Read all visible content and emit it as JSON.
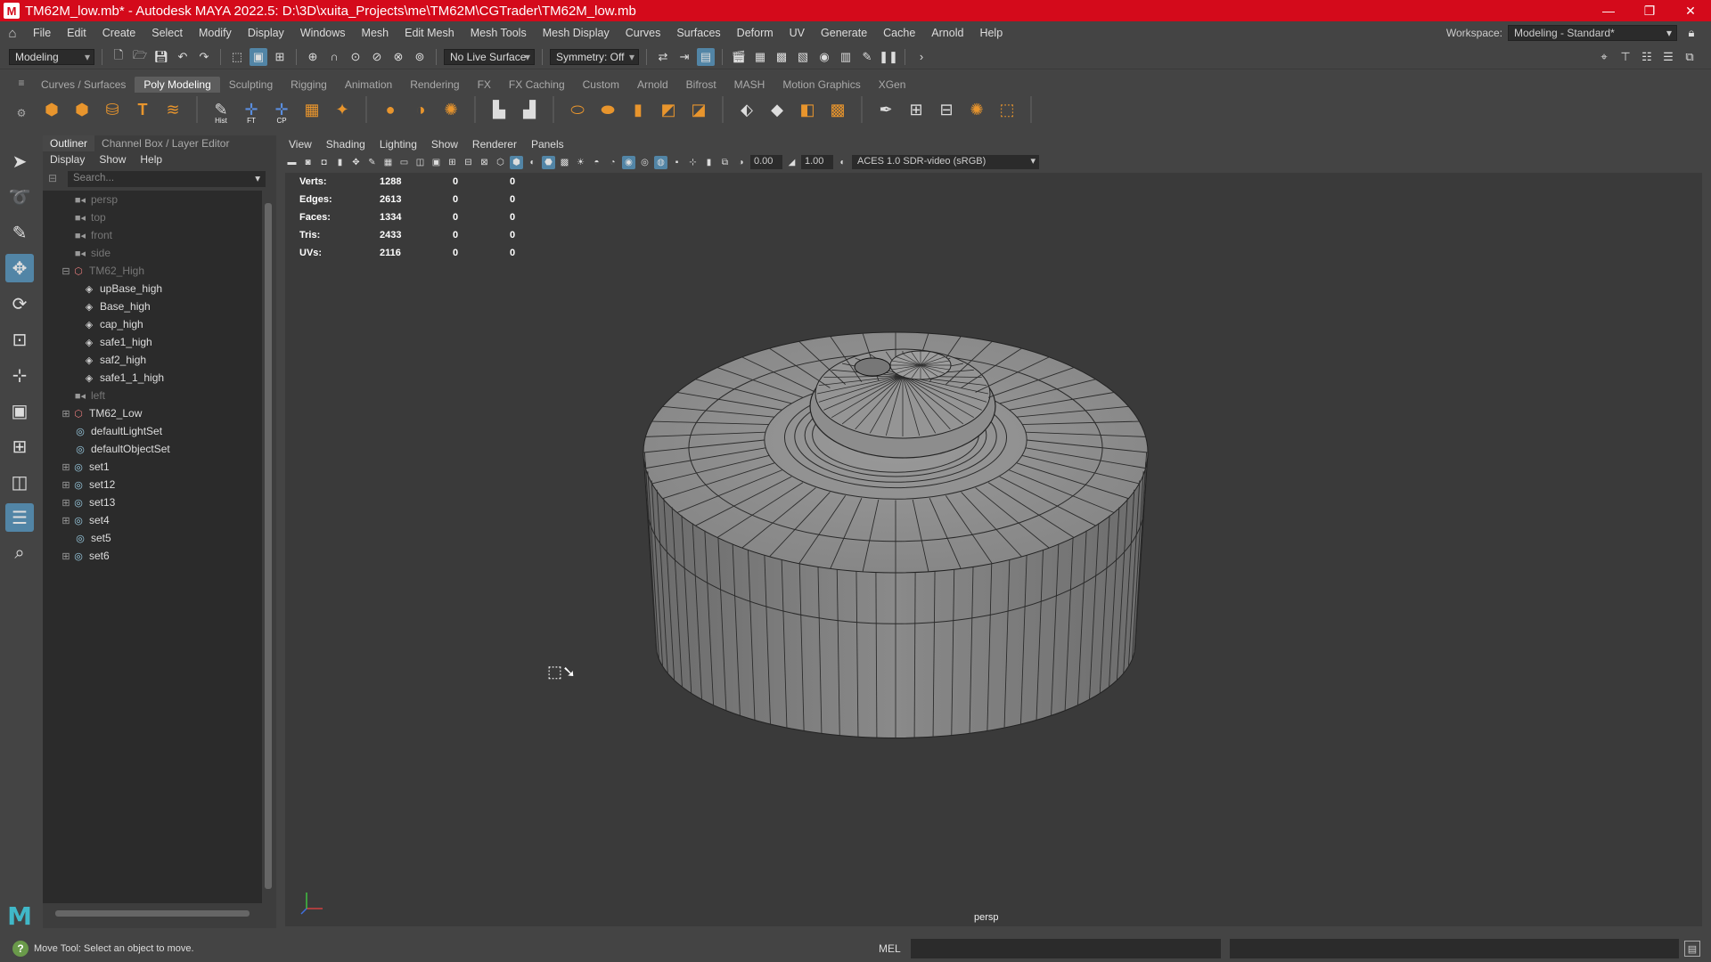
{
  "window": {
    "title": "TM62M_low.mb* - Autodesk MAYA 2022.5: D:\\3D\\xuita_Projects\\me\\TM62M\\CGTrader\\TM62M_low.mb",
    "app_icon": "M"
  },
  "menubar": {
    "items": [
      "File",
      "Edit",
      "Create",
      "Select",
      "Modify",
      "Display",
      "Windows",
      "Mesh",
      "Edit Mesh",
      "Mesh Tools",
      "Mesh Display",
      "Curves",
      "Surfaces",
      "Deform",
      "UV",
      "Generate",
      "Cache",
      "Arnold",
      "Help"
    ],
    "workspace_label": "Workspace:",
    "workspace_value": "Modeling - Standard*"
  },
  "statusline": {
    "menuset": "Modeling",
    "live_surface": "No Live Surface",
    "symmetry": "Symmetry: Off"
  },
  "shelf": {
    "tabs": [
      "Curves / Surfaces",
      "Poly Modeling",
      "Sculpting",
      "Rigging",
      "Animation",
      "Rendering",
      "FX",
      "FX Caching",
      "Custom",
      "Arnold",
      "Bifrost",
      "MASH",
      "Motion Graphics",
      "XGen"
    ],
    "active_tab": "Poly Modeling",
    "labels": {
      "hist": "Hist",
      "ft": "FT",
      "cp": "CP"
    }
  },
  "outliner": {
    "tabs": [
      "Outliner",
      "Channel Box / Layer Editor"
    ],
    "menu": [
      "Display",
      "Show",
      "Help"
    ],
    "search_placeholder": "Search...",
    "nodes": [
      {
        "label": "persp",
        "dim": true
      },
      {
        "label": "top",
        "dim": true
      },
      {
        "label": "front",
        "dim": true
      },
      {
        "label": "side",
        "dim": true
      },
      {
        "label": "TM62_High",
        "dim": true
      },
      {
        "label": "upBase_high"
      },
      {
        "label": "Base_high"
      },
      {
        "label": "cap_high"
      },
      {
        "label": "safe1_high"
      },
      {
        "label": "saf2_high"
      },
      {
        "label": "safe1_1_high"
      },
      {
        "label": "left",
        "dim": true
      },
      {
        "label": "TM62_Low"
      },
      {
        "label": "defaultLightSet"
      },
      {
        "label": "defaultObjectSet"
      },
      {
        "label": "set1"
      },
      {
        "label": "set12"
      },
      {
        "label": "set13"
      },
      {
        "label": "set4"
      },
      {
        "label": "set5"
      },
      {
        "label": "set6"
      }
    ]
  },
  "viewport": {
    "menu": [
      "View",
      "Shading",
      "Lighting",
      "Show",
      "Renderer",
      "Panels"
    ],
    "exposure": "0.00",
    "gamma": "1.00",
    "color_space": "ACES 1.0 SDR-video (sRGB)",
    "camera": "persp",
    "hud": [
      {
        "label": "Verts:",
        "v1": "1288",
        "v2": "0",
        "v3": "0"
      },
      {
        "label": "Edges:",
        "v1": "2613",
        "v2": "0",
        "v3": "0"
      },
      {
        "label": "Faces:",
        "v1": "1334",
        "v2": "0",
        "v3": "0"
      },
      {
        "label": "Tris:",
        "v1": "2433",
        "v2": "0",
        "v3": "0"
      },
      {
        "label": "UVs:",
        "v1": "2116",
        "v2": "0",
        "v3": "0"
      }
    ]
  },
  "helpline": {
    "text": "Move Tool: Select an object to move.",
    "mel": "MEL"
  }
}
